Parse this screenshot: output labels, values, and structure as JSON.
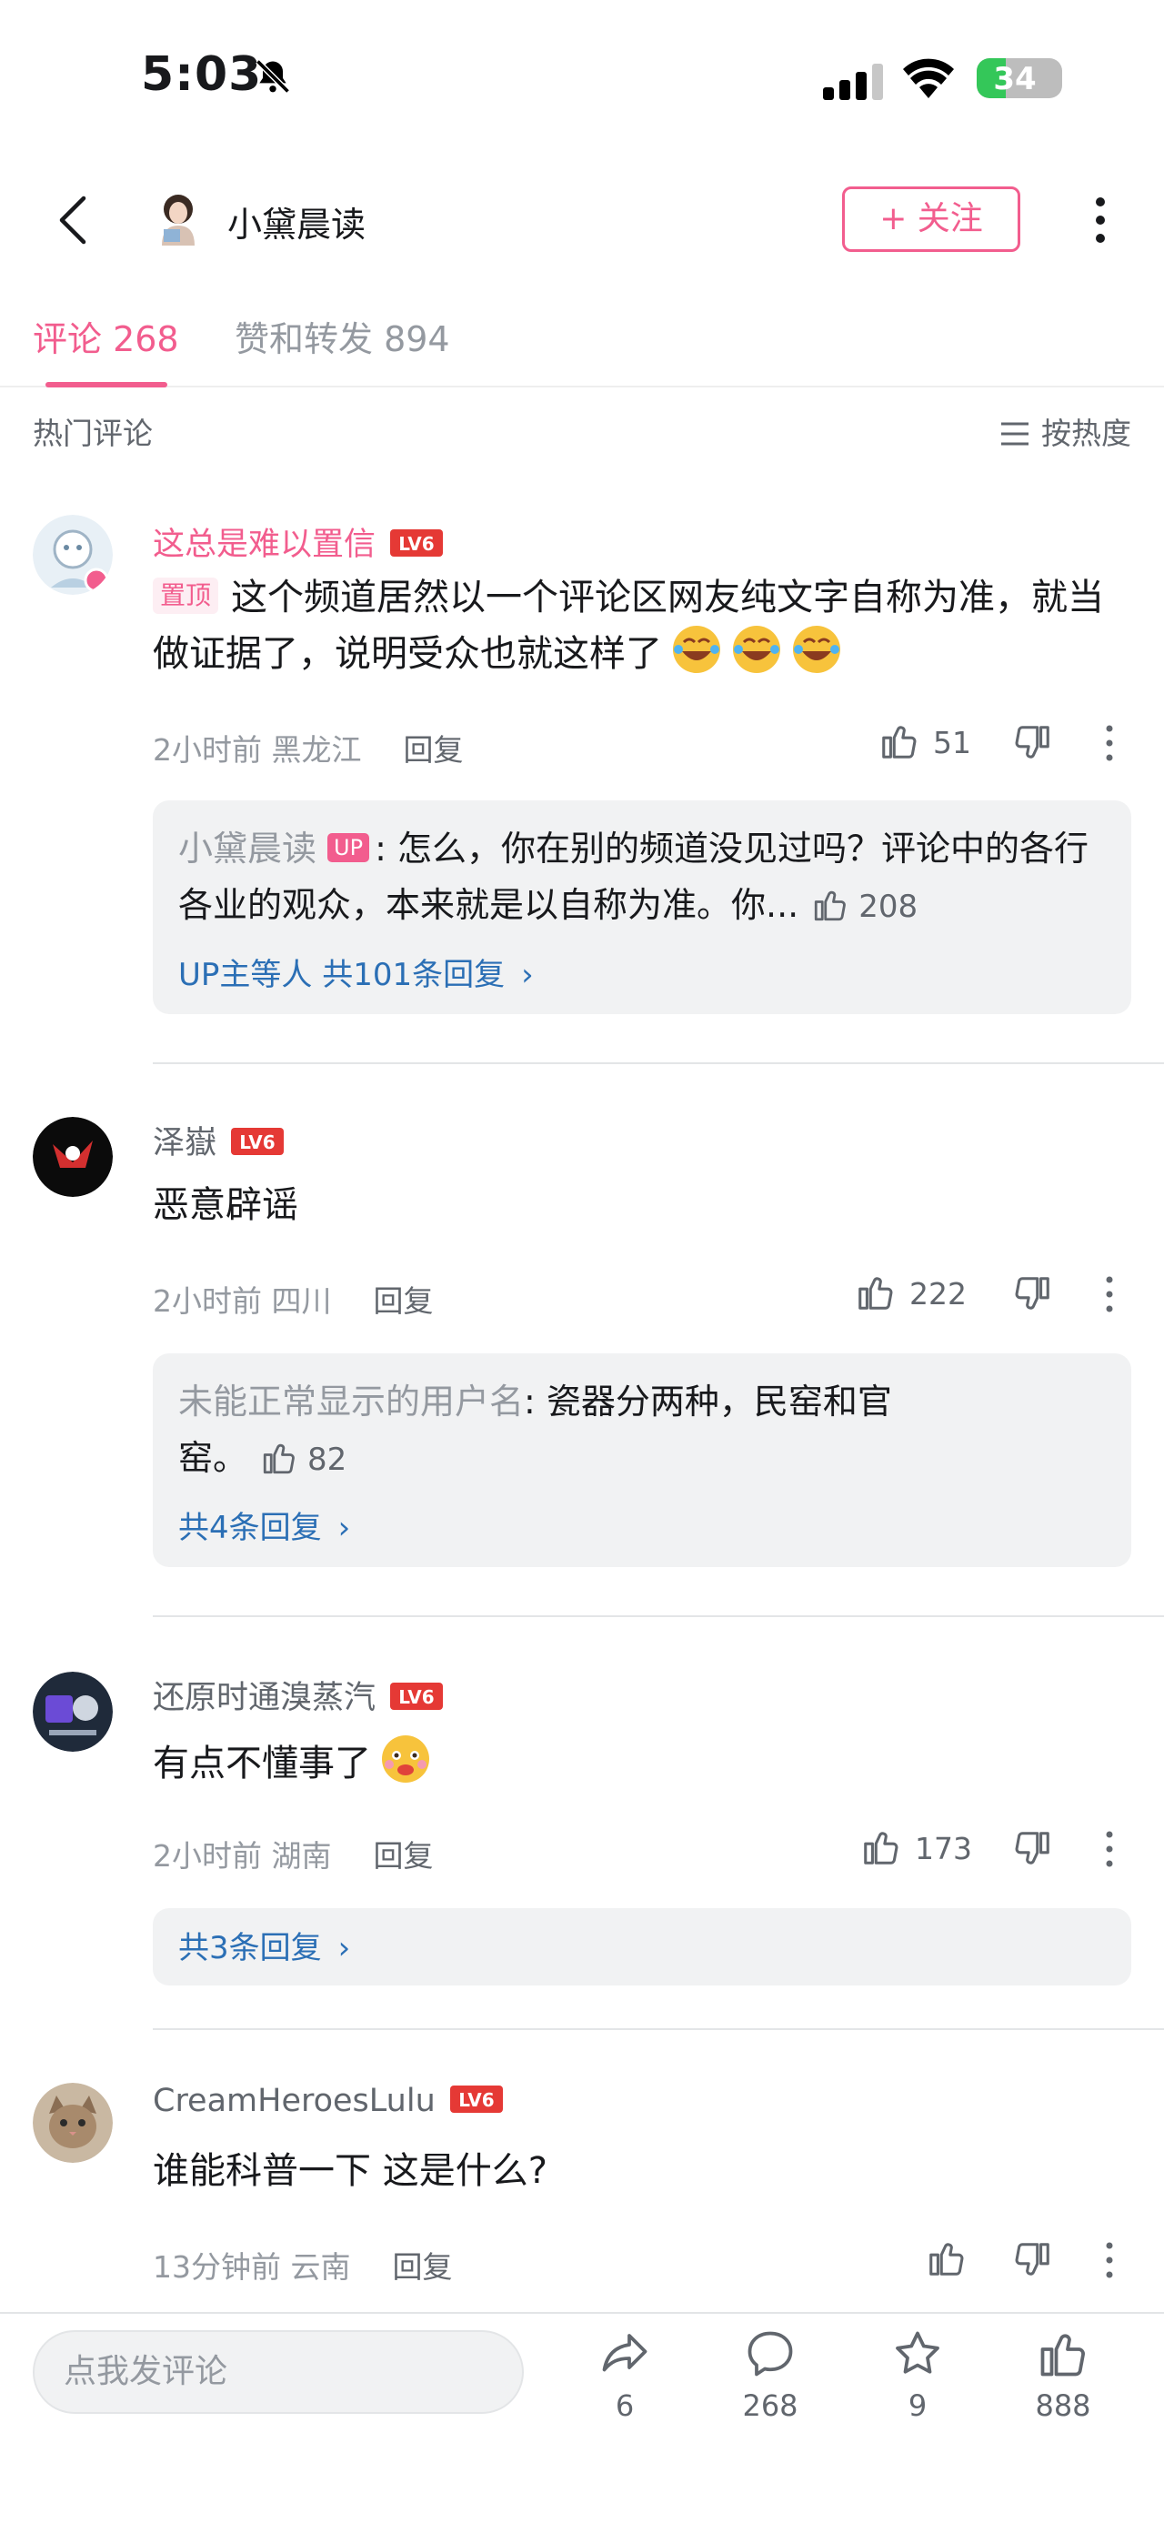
{
  "status_bar": {
    "time": "5:03",
    "battery": "34",
    "battery_level": 0.34
  },
  "nav": {
    "uploader_name": "小黛晨读",
    "follow_label": "+ 关注"
  },
  "tabs": [
    {
      "label": "评论 268",
      "active": true
    },
    {
      "label": "赞和转发 894",
      "active": false
    }
  ],
  "sort": {
    "section_title": "热门评论",
    "sort_label": "按热度"
  },
  "comments": [
    {
      "username": "这总是难以置信",
      "level": "LV6",
      "pinned_label": "置顶",
      "text": "这个频道居然以一个评论区网友纯文字自称为准，就当做证据了，说明受众也就这样了",
      "time": "2小时前",
      "location": "黑龙江",
      "reply_label": "回复",
      "likes": "51",
      "sub": {
        "name": "小黛晨读",
        "badge": "UP",
        "text": ": 怎么，你在别的频道没见过吗？评论中的各行各业的观众，本来就是以自称为准。你...",
        "likes": "208",
        "link": "UP主等人 共101条回复"
      }
    },
    {
      "username": "泽嶽",
      "level": "LV6",
      "text": "恶意辟谣",
      "time": "2小时前",
      "location": "四川",
      "reply_label": "回复",
      "likes": "222",
      "sub": {
        "name": "未能正常显示的用户名",
        "text": ": 瓷器分两种，民窑和官窑。",
        "likes": "82",
        "link": "共4条回复"
      }
    },
    {
      "username": "还原时通溴蒸汽",
      "level": "LV6",
      "text": "有点不懂事了",
      "time": "2小时前",
      "location": "湖南",
      "reply_label": "回复",
      "likes": "173",
      "sub": {
        "link": "共3条回复"
      }
    },
    {
      "username": "CreamHeroesLulu",
      "level": "LV6",
      "text": "谁能科普一下 这是什么?",
      "time": "13分钟前",
      "location": "云南",
      "reply_label": "回复",
      "likes": ""
    }
  ],
  "bottom_bar": {
    "input_placeholder": "点我发评论",
    "share_count": "6",
    "comment_count": "268",
    "favorite_count": "9",
    "like_count": "888"
  },
  "colors": {
    "accent": "#f25d8e",
    "link": "#2b6fb5",
    "level_badge": "#e53935"
  }
}
